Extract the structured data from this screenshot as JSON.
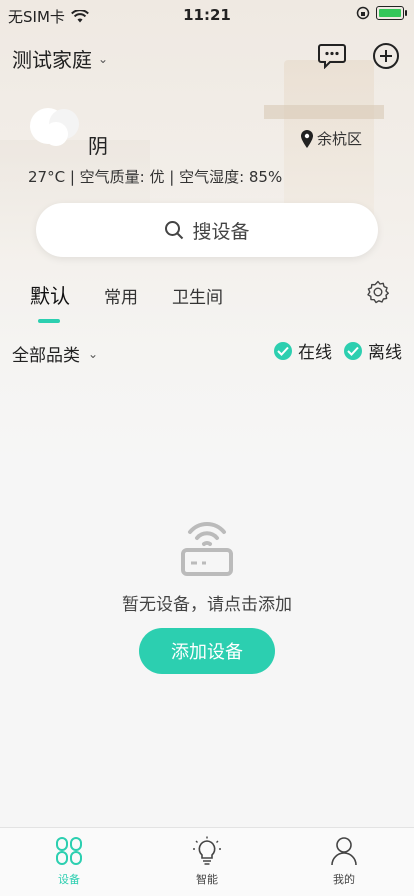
{
  "status_bar": {
    "carrier": "无SIM卡",
    "time": "11:21"
  },
  "header": {
    "home_name": "测试家庭"
  },
  "weather": {
    "condition": "阴",
    "location": "余杭区",
    "metrics": "27°C | 空气质量: 优 | 空气湿度: 85%"
  },
  "search": {
    "label": "搜设备"
  },
  "tabs": [
    {
      "label": "默认",
      "active": true
    },
    {
      "label": "常用",
      "active": false
    },
    {
      "label": "卫生间",
      "active": false
    }
  ],
  "filters": {
    "category": "全部品类",
    "online": "在线",
    "offline": "离线"
  },
  "empty_state": {
    "message": "暂无设备，请点击添加",
    "add_button": "添加设备"
  },
  "bottom_nav": [
    {
      "label": "设备",
      "icon": "devices-icon",
      "active": true
    },
    {
      "label": "智能",
      "icon": "lightbulb-icon",
      "active": false
    },
    {
      "label": "我的",
      "icon": "profile-icon",
      "active": false
    }
  ],
  "colors": {
    "accent": "#2ccfb0",
    "battery": "#33c759"
  }
}
